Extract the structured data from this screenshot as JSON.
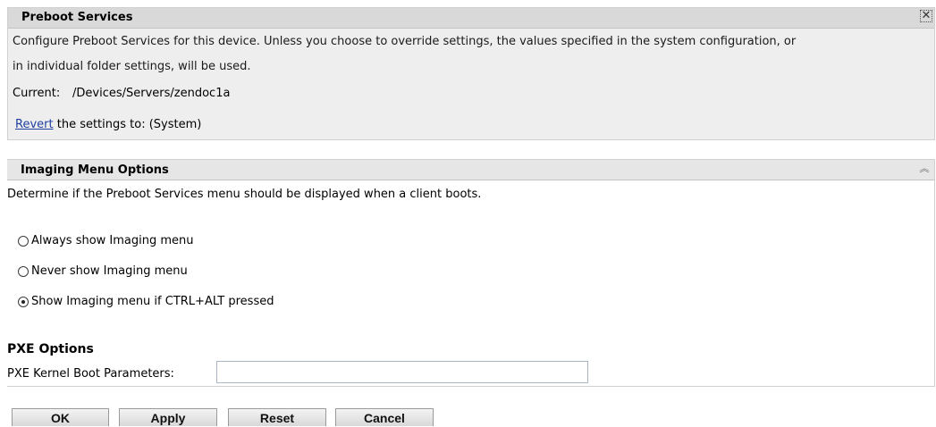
{
  "preboot": {
    "title": "Preboot Services",
    "description_line1": "Configure Preboot Services for this device. Unless you choose to override settings, the values specified in the system configuration, or",
    "description_line2": "in individual folder settings, will be used.",
    "current_label": "Current:",
    "current_path": "/Devices/Servers/zendoc1a",
    "revert_link": "Revert",
    "revert_text": " the settings to: (System)"
  },
  "imaging": {
    "title": "Imaging Menu Options",
    "description": "Determine if the Preboot Services menu should be displayed when a client boots.",
    "options": [
      {
        "label": "Always show Imaging menu",
        "checked": false
      },
      {
        "label": "Never show Imaging menu",
        "checked": false
      },
      {
        "label": "Show Imaging menu if CTRL+ALT pressed",
        "checked": true
      }
    ]
  },
  "pxe": {
    "title": "PXE Options",
    "kernel_label": "PXE Kernel Boot Parameters:",
    "kernel_value": ""
  },
  "buttons": {
    "ok": "OK",
    "apply": "Apply",
    "reset": "Reset",
    "cancel": "Cancel"
  }
}
